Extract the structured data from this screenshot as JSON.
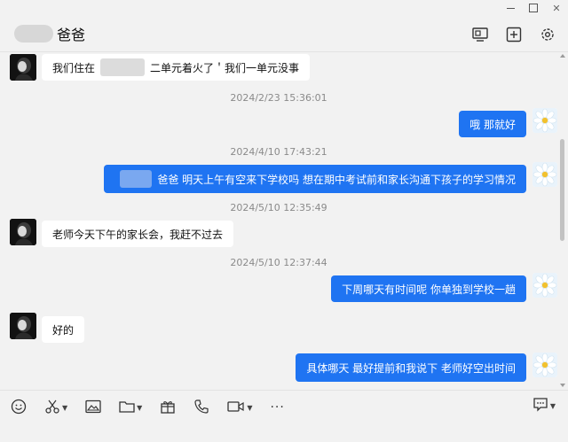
{
  "window": {
    "controls": [
      "minimize",
      "maximize",
      "close"
    ]
  },
  "header": {
    "title": "爸爸",
    "icons": [
      "screen-share-icon",
      "add-member-icon",
      "settings-icon"
    ]
  },
  "messages": [
    {
      "side": "in",
      "parts": [
        "我们住在",
        "",
        "二单元着火了＇我们一单元没事"
      ]
    },
    {
      "type": "time",
      "text": "2024/2/23 15:36:01"
    },
    {
      "side": "out",
      "text": "哦 那就好"
    },
    {
      "type": "time",
      "text": "2024/4/10 17:43:21"
    },
    {
      "side": "out",
      "parts": [
        "",
        "爸爸 明天上午有空来下学校吗 想在期中考试前和家长沟通下孩子的学习情况"
      ]
    },
    {
      "type": "time",
      "text": "2024/5/10 12:35:49"
    },
    {
      "side": "in",
      "text": "老师今天下午的家长会，我赶不过去"
    },
    {
      "type": "time",
      "text": "2024/5/10 12:37:44"
    },
    {
      "side": "out",
      "text": "下周哪天有时间呢 你单独到学校一趟"
    },
    {
      "side": "in",
      "text": "好的"
    },
    {
      "side": "out",
      "text": "具体哪天 最好提前和我说下 老师好空出时间"
    }
  ],
  "toolbar": {
    "icons": [
      "emoji-icon",
      "scissors-icon",
      "image-icon",
      "folder-icon",
      "gift-icon",
      "phone-icon",
      "video-icon",
      "more-icon"
    ],
    "more_label": "···",
    "right_icon": "chat-history-icon"
  },
  "colors": {
    "accent": "#1f74f2",
    "background": "#f2f2f2",
    "bubble_in": "#ffffff"
  }
}
